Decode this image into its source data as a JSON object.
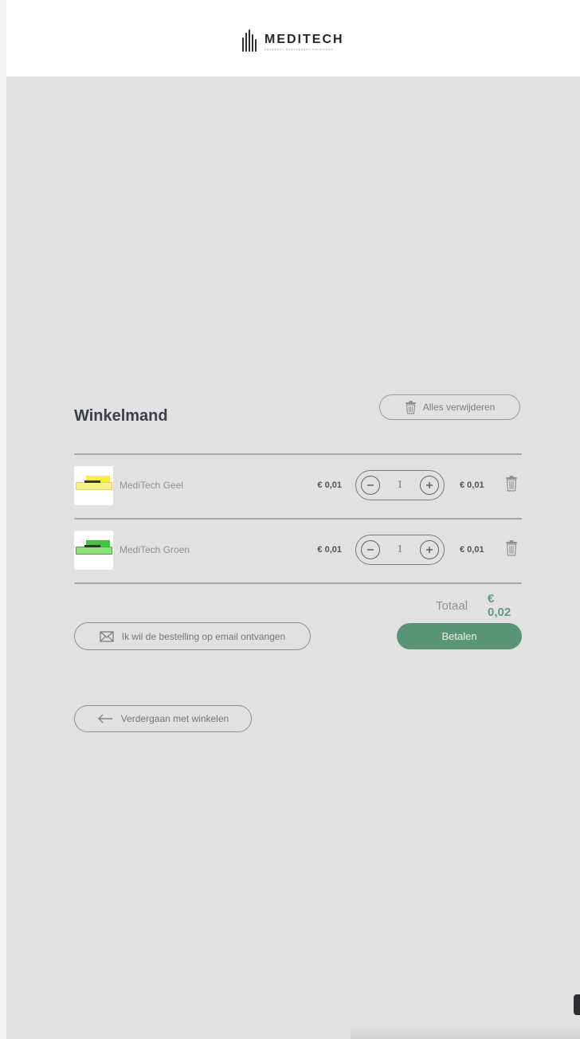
{
  "header": {
    "brand_name": "MEDITECH",
    "brand_tagline": "Pharmacy Management Solutions"
  },
  "cart": {
    "title": "Winkelmand",
    "remove_all_label": "Alles verwijderen",
    "items": [
      {
        "name": "MediTech Geel",
        "unit_price": "€ 0,01",
        "quantity": "1",
        "line_total": "€ 0,01",
        "accent_color": "#f5ee3a"
      },
      {
        "name": "MediTech Groen",
        "unit_price": "€ 0,01",
        "quantity": "1",
        "line_total": "€ 0,01",
        "accent_color": "#43c43e"
      }
    ],
    "total_label": "Totaal",
    "total_value": "€ 0,02",
    "email_button_label": "Ik wil de bestelling op email ontvangen",
    "pay_button_label": "Betalen",
    "continue_button_label": "Verdergaan met winkelen"
  },
  "icons": {
    "trash": "trash-icon",
    "minus": "minus-circle-icon",
    "plus": "plus-circle-icon",
    "mail": "mail-icon",
    "arrow_left": "arrow-left-icon"
  },
  "colors": {
    "background": "#e1e1e1",
    "header": "#ffffff",
    "accent_green": "#5a9478",
    "total_green": "#5c9b80"
  }
}
